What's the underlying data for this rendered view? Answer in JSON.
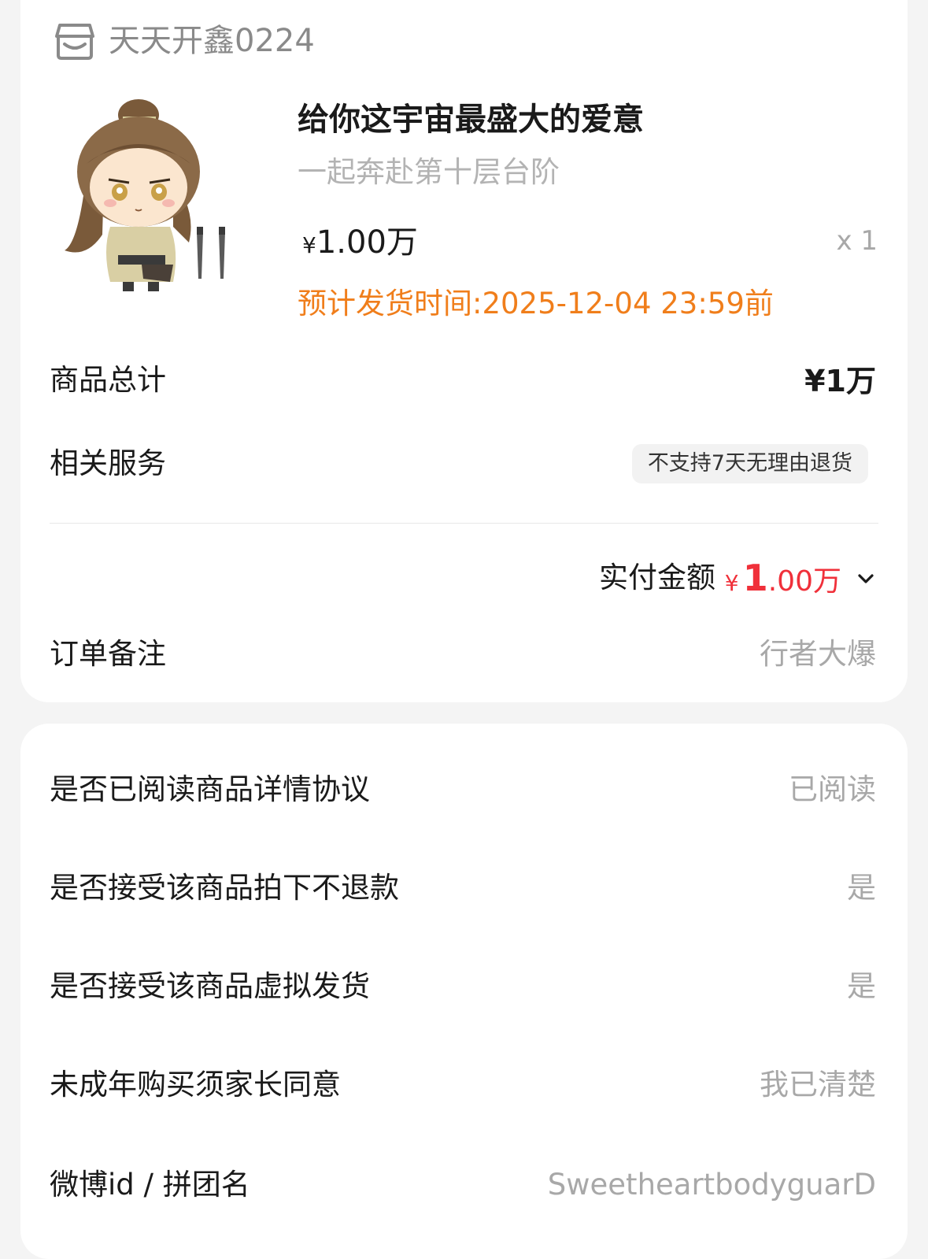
{
  "shop": {
    "name": "天天开鑫0224",
    "icon": "shop-icon"
  },
  "product": {
    "title": "给你这宇宙最盛大的爱意",
    "subtitle": "一起奔赴第十层台阶",
    "price_currency": "¥",
    "price_value": "1.00万",
    "quantity": "x 1",
    "ship_time": "预计发货时间:2025-12-04 23:59前"
  },
  "summary": {
    "total_label": "商品总计",
    "total_value": "¥1万",
    "service_label": "相关服务",
    "service_tag": "不支持7天无理由退货",
    "paid_label": "实付金额",
    "paid_currency": "¥",
    "paid_int": "1",
    "paid_frac": ".00万",
    "note_label": "订单备注",
    "note_value": "行者大爆"
  },
  "info_rows": [
    {
      "label": "是否已阅读商品详情协议",
      "value": "已阅读"
    },
    {
      "label": "是否接受该商品拍下不退款",
      "value": "是"
    },
    {
      "label": "是否接受该商品虚拟发货",
      "value": "是"
    },
    {
      "label": "未成年购买须家长同意",
      "value": "我已清楚"
    },
    {
      "label": "微博id / 拼团名",
      "value": "SweetheartbodyguarD"
    }
  ],
  "colors": {
    "accent_red": "#f0303a",
    "ship_orange": "#f07e1b",
    "muted": "#a8a8a8"
  }
}
